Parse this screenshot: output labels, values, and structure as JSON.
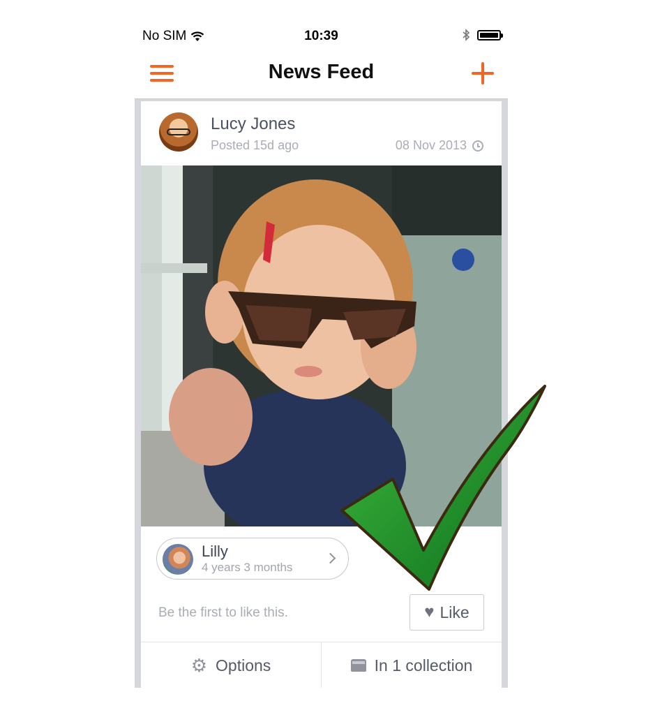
{
  "status_bar": {
    "carrier": "No SIM",
    "time": "10:39",
    "wifi_icon": "wifi-icon",
    "bluetooth_icon": "bluetooth-icon",
    "battery_icon": "battery-icon"
  },
  "nav": {
    "title": "News Feed",
    "menu_icon": "hamburger-icon",
    "add_icon": "plus-icon",
    "accent_color": "#f26522"
  },
  "post": {
    "author": "Lucy Jones",
    "posted": "Posted 15d ago",
    "date": "08 Nov 2013",
    "child": {
      "name": "Lilly",
      "age": "4 years 3 months"
    },
    "like_prompt": "Be the first to like this.",
    "like_label": "Like",
    "options_label": "Options",
    "collection_label": "In 1 collection"
  }
}
